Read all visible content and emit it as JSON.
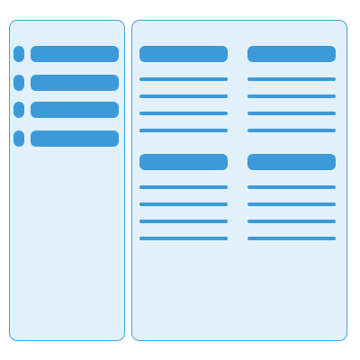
{
  "theme": {
    "panel_background": "#e1f0fa",
    "panel_border": "#4a9fd8",
    "accent": "#3d9ad9"
  },
  "sidebar": {
    "items": [
      {
        "label": ""
      },
      {
        "label": ""
      },
      {
        "label": ""
      },
      {
        "label": ""
      }
    ]
  },
  "main": {
    "cards": [
      {
        "title": "",
        "lines": [
          "",
          "",
          "",
          ""
        ]
      },
      {
        "title": "",
        "lines": [
          "",
          "",
          "",
          ""
        ]
      },
      {
        "title": "",
        "lines": [
          "",
          "",
          "",
          ""
        ]
      },
      {
        "title": "",
        "lines": [
          "",
          "",
          "",
          ""
        ]
      }
    ]
  }
}
